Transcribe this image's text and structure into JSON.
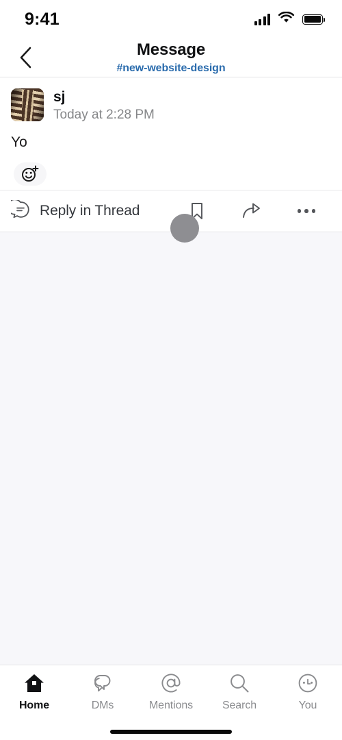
{
  "status_bar": {
    "time": "9:41",
    "signal_icon": "cellular-signal-icon",
    "wifi_icon": "wifi-icon",
    "battery_icon": "battery-full-icon"
  },
  "header": {
    "back_icon": "chevron-left-icon",
    "title": "Message",
    "channel": "#new-website-design",
    "channel_color": "#2b6cad"
  },
  "message": {
    "avatar_name": "user-avatar",
    "author": "sj",
    "timestamp": "Today at 2:28 PM",
    "text": "Yo",
    "add_reaction_icon": "add-reaction-smiley-plus-icon"
  },
  "actions": {
    "reply_icon": "thread-reply-bubble-icon",
    "reply_label": "Reply in Thread",
    "bookmark_icon": "bookmark-icon",
    "share_icon": "share-forward-arrow-icon",
    "more_icon": "more-options-ellipsis-icon"
  },
  "cursor": {
    "name": "touch-indicator",
    "color": "#8e8e92"
  },
  "bottom_nav": {
    "items": [
      {
        "label": "Home",
        "icon": "home-icon",
        "active": true
      },
      {
        "label": "DMs",
        "icon": "dms-icon",
        "active": false
      },
      {
        "label": "Mentions",
        "icon": "mentions-at-icon",
        "active": false
      },
      {
        "label": "Search",
        "icon": "search-icon",
        "active": false
      },
      {
        "label": "You",
        "icon": "you-profile-icon",
        "active": false
      }
    ]
  },
  "home_indicator": {
    "name": "home-indicator"
  }
}
